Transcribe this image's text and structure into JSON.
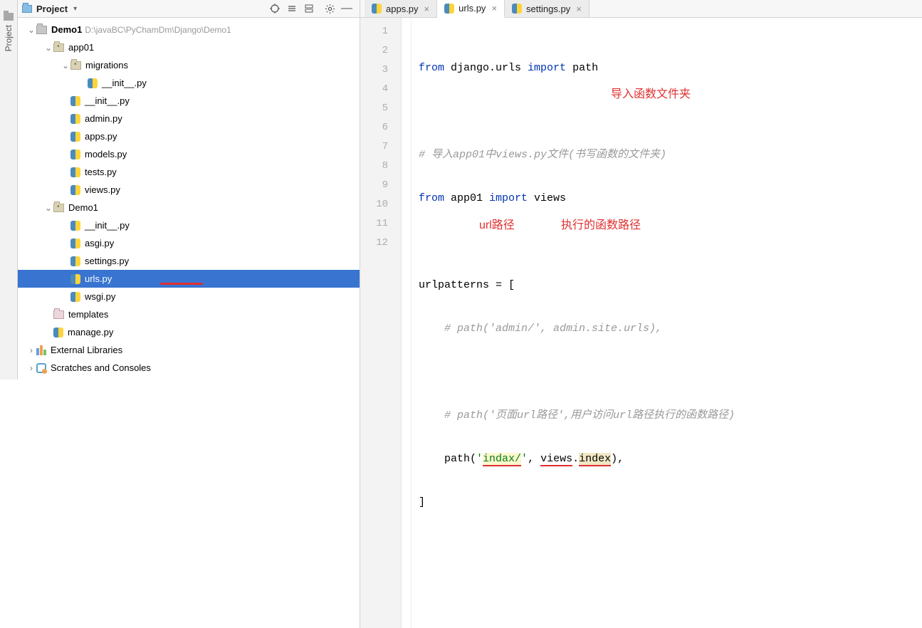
{
  "sidebar_vert": "Project",
  "project_toolbar": {
    "label": "Project"
  },
  "tabs": [
    {
      "label": "apps.py"
    },
    {
      "label": "urls.py"
    },
    {
      "label": "settings.py"
    }
  ],
  "tree": {
    "root": {
      "name": "Demo1",
      "path": "D:\\javaBC\\PyChamDm\\Django\\Demo1"
    },
    "app01": {
      "name": "app01"
    },
    "migrations": {
      "name": "migrations"
    },
    "mig_init": "__init__.py",
    "app_init": "__init__.py",
    "admin": "admin.py",
    "apps": "apps.py",
    "models": "models.py",
    "tests": "tests.py",
    "views": "views.py",
    "demo1": {
      "name": "Demo1"
    },
    "d_init": "__init__.py",
    "asgi": "asgi.py",
    "settings": "settings.py",
    "urls": "urls.py",
    "wsgi": "wsgi.py",
    "templates": "templates",
    "manage": "manage.py",
    "ext": "External Libraries",
    "scratch": "Scratches and Consoles"
  },
  "code": {
    "l1a": "from",
    "l1b": " django.urls ",
    "l1c": "import",
    "l1d": " path",
    "l3": "# 导入app01中views.py文件(书写函数的文件夹)",
    "l4a": "from",
    "l4b": " app01 ",
    "l4c": "import",
    "l4d": " views",
    "l6": "urlpatterns = [",
    "l7": "    # path('admin/', admin.site.urls),",
    "l9": "    # path('页面url路径',用户访问url路径执行的函数路径)",
    "l10a": "    path(",
    "l10b": "'",
    "l10c": "indax/",
    "l10d": "'",
    "l10e": ", ",
    "l10f": "views",
    "l10g": ".",
    "l10h": "index",
    "l10i": "),",
    "l11": "]"
  },
  "anno": {
    "a1": "导入函数文件夹",
    "a2": "url路径",
    "a3": "执行的函数路径"
  },
  "line_numbers": [
    "1",
    "2",
    "3",
    "4",
    "5",
    "6",
    "7",
    "8",
    "9",
    "10",
    "11",
    "12"
  ]
}
